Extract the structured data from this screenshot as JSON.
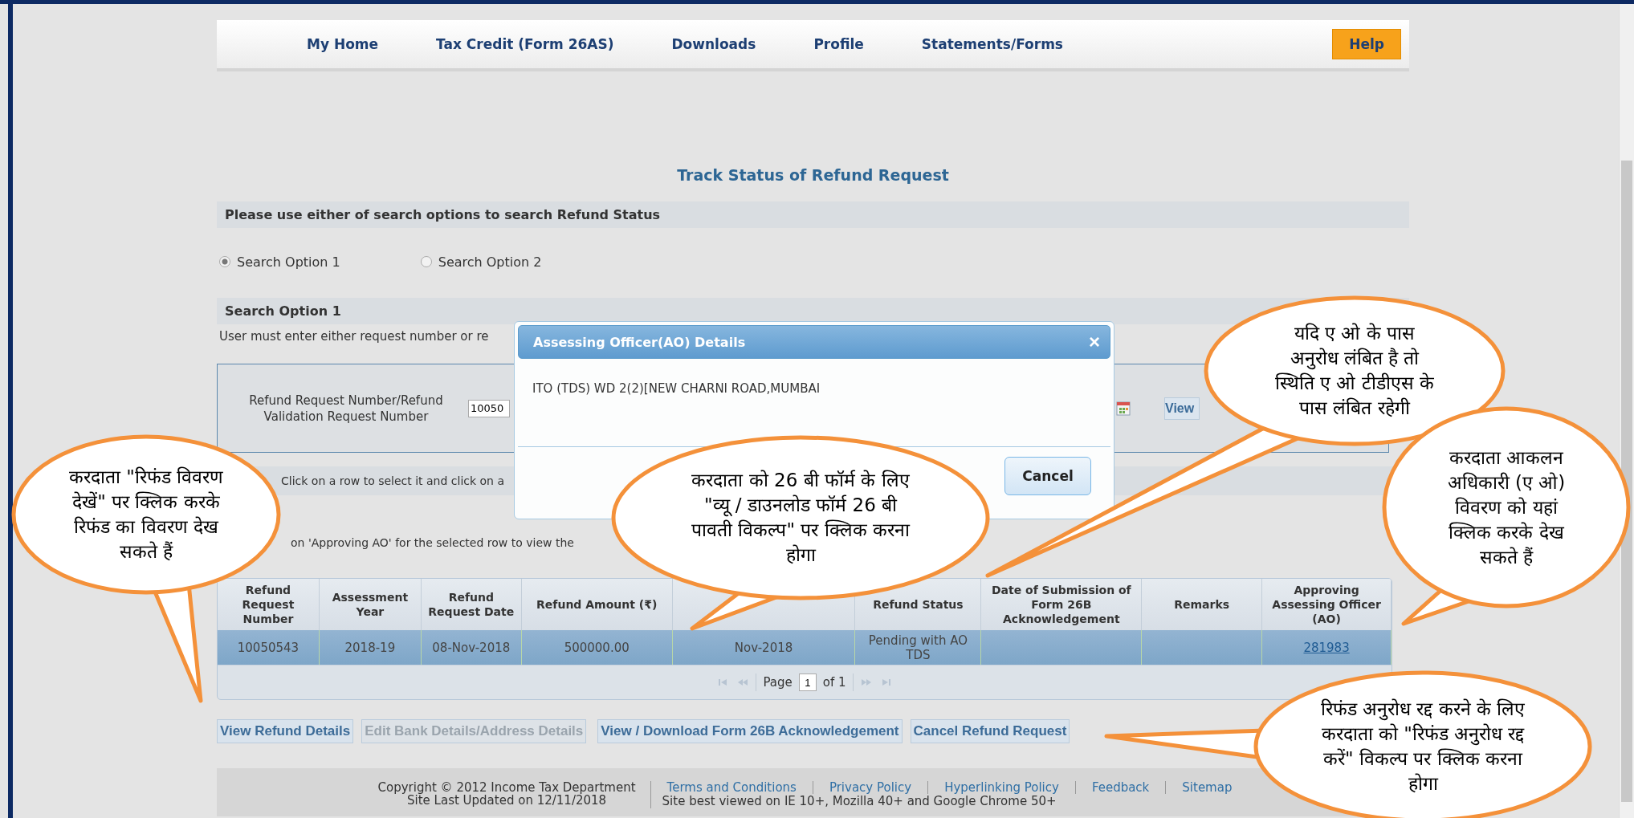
{
  "nav": {
    "items": [
      {
        "label": "My Home"
      },
      {
        "label": "Tax Credit (Form 26AS)"
      },
      {
        "label": "Downloads"
      },
      {
        "label": "Profile"
      },
      {
        "label": "Statements/Forms"
      }
    ],
    "help": "Help"
  },
  "page_title": "Track Status of Refund Request",
  "search_heading": "Please use either of search options to search Refund Status",
  "search_options": [
    {
      "label": "Search Option 1",
      "selected": true
    },
    {
      "label": "Search Option 2",
      "selected": false
    }
  ],
  "option_heading": "Search Option 1",
  "option_note": "User must enter either request number or re",
  "request_field": {
    "label": "Refund Request Number/Refund Validation Request Number",
    "value": "10050"
  },
  "view_button": "View",
  "row_hint": "Click on a row to select it and click on a",
  "ao_hint": "on 'Approving AO' for the selected row to view the",
  "table": {
    "columns": [
      {
        "label": "Refund Request Number"
      },
      {
        "label": "Assessment Year"
      },
      {
        "label": "Refund Request Date"
      },
      {
        "label": "Refund Amount (₹)"
      },
      {},
      {
        "label": "Refund Status"
      },
      {
        "label": "Date of Submission of Form 26B Acknowledgement"
      },
      {
        "label": "Remarks"
      },
      {
        "label": "Approving Assessing Officer (AO)"
      }
    ],
    "rows": [
      {
        "selected": true,
        "request_number": "10050543",
        "assessment_year": "2018-19",
        "request_date": "08-Nov-2018",
        "amount": "500000.00",
        "column_6": "Nov-2018",
        "status": "Pending with AO TDS",
        "ao": "281983"
      }
    ],
    "pager": {
      "label": "Page",
      "page": "1",
      "of": "of 1"
    }
  },
  "actions": [
    {
      "label": "View Refund Details",
      "disabled": false
    },
    {
      "label": "Edit Bank Details/Address Details",
      "disabled": true
    },
    {
      "label": "View / Download Form 26B Acknowledgement",
      "disabled": false
    },
    {
      "label": "Cancel Refund Request",
      "disabled": false
    }
  ],
  "footer": {
    "copyright": "Copyright © 2012 Income Tax Department",
    "updated": "Site Last Updated on 12/11/2018",
    "links": [
      "Terms and Conditions",
      "Privacy Policy",
      "Hyperlinking Policy",
      "Feedback",
      "Sitemap"
    ],
    "browsers": "Site best viewed on IE 10+, Mozilla 40+ and Google Chrome 50+"
  },
  "dialog": {
    "title": "Assessing Officer(AO) Details",
    "close": "×",
    "body": "ITO (TDS) WD 2(2)[NEW CHARNI ROAD,MUMBAI",
    "cancel": "Cancel"
  },
  "callouts": [
    {
      "text": "करदाता \"रिफंड विवरण देखें\" पर क्लिक करके रिफंड का विवरण देख सकते हैं"
    },
    {
      "text": "करदाता को 26 बी फॉर्म के लिए \"व्यू / डाउनलोड फॉर्म 26 बी पावती विकल्प\" पर क्लिक करना होगा"
    },
    {
      "text": "यदि ए ओ के पास अनुरोध लंबित है तो स्थिति ए ओ टीडीएस के पास लंबित रहेगी"
    },
    {
      "text": "करदाता आकलन अधिकारी (ए ओ) विवरण को यहां क्लिक करके देख सकते हैं"
    },
    {
      "text": "रिफंड अनुरोध रद्द करने के लिए करदाता को \"रिफंड अनुरोध रद्द करें\" विकल्प पर क्लिक करना होगा"
    }
  ]
}
